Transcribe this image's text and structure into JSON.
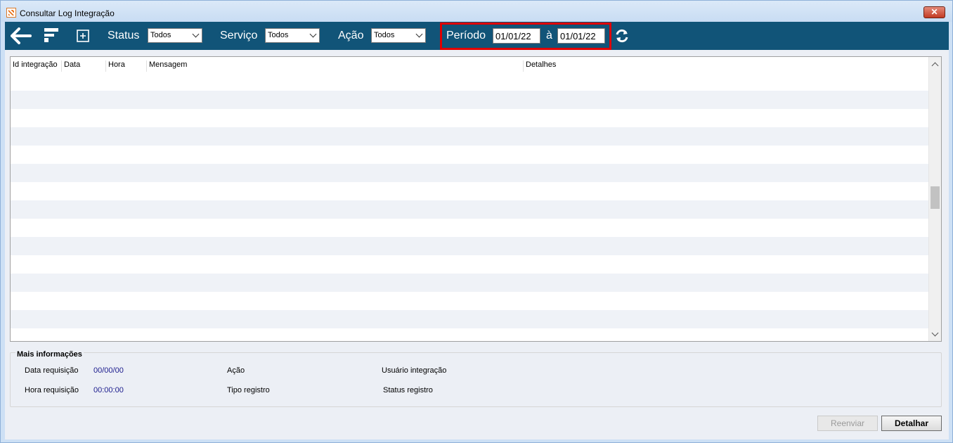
{
  "window": {
    "title": "Consultar Log Integração"
  },
  "toolbar": {
    "status_label": "Status",
    "status_value": "Todos",
    "servico_label": "Serviço",
    "servico_value": "Todos",
    "acao_label": "Ação",
    "acao_value": "Todos",
    "periodo_label": "Período",
    "periodo_from": "01/01/22",
    "periodo_sep": "à",
    "periodo_to": "01/01/22"
  },
  "grid": {
    "columns": [
      "Id integração",
      "Data",
      "Hora",
      "Mensagem",
      "Detalhes"
    ]
  },
  "info": {
    "title": "Mais informações",
    "data_requisicao_label": "Data requisição",
    "data_requisicao_value": "00/00/00",
    "hora_requisicao_label": "Hora requisição",
    "hora_requisicao_value": "00:00:00",
    "acao_label": "Ação",
    "tipo_registro_label": "Tipo registro",
    "usuario_integracao_label": "Usuário integração",
    "status_registro_label": "Status registro"
  },
  "buttons": {
    "reenviar": "Reenviar",
    "detalhar": "Detalhar"
  },
  "colors": {
    "toolbar": "#115478",
    "highlight": "#e00000",
    "row_alt": "#eff2f7"
  }
}
